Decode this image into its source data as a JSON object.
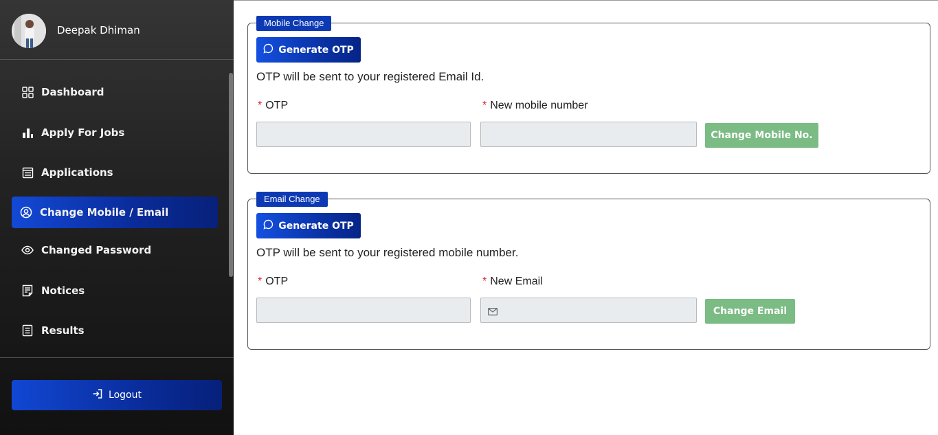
{
  "user": {
    "name": "Deepak Dhiman"
  },
  "sidebar": {
    "items": [
      {
        "label": "Dashboard",
        "icon": "grid-icon"
      },
      {
        "label": "Apply For Jobs",
        "icon": "bar-chart-icon"
      },
      {
        "label": "Applications",
        "icon": "clipboard-list-icon"
      },
      {
        "label": "Change Mobile / Email",
        "icon": "user-circle-icon",
        "active": true
      },
      {
        "label": "Changed Password",
        "icon": "eye-icon"
      },
      {
        "label": "Notices",
        "icon": "notice-icon"
      },
      {
        "label": "Results",
        "icon": "document-icon"
      }
    ],
    "logout_label": "Logout"
  },
  "mobile_change": {
    "legend": "Mobile Change",
    "generate_otp_label": "Generate OTP",
    "info": "OTP will be sent to your registered Email Id.",
    "required_mark": "*",
    "otp_label": "OTP",
    "otp_value": "",
    "new_value_label": "New mobile number",
    "new_value": "",
    "submit_label": "Change Mobile No."
  },
  "email_change": {
    "legend": "Email Change",
    "generate_otp_label": "Generate OTP",
    "info": "OTP will be sent to your registered mobile number.",
    "required_mark": "*",
    "otp_label": "OTP",
    "otp_value": "",
    "new_value_label": "New Email",
    "new_value": "",
    "submit_label": "Change Email"
  },
  "colors": {
    "primary": "#0d3ab4",
    "submit": "#7bbb84",
    "required": "#e02020"
  }
}
